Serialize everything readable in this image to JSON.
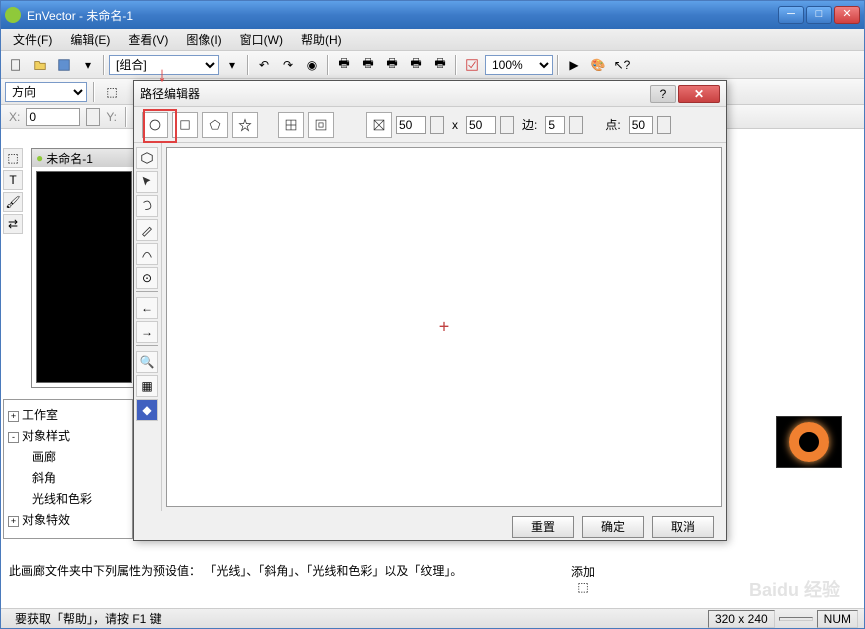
{
  "app": {
    "title": "EnVector - 未命名-1"
  },
  "menus": [
    "文件(F)",
    "编辑(E)",
    "查看(V)",
    "图像(I)",
    "窗口(W)",
    "帮助(H)"
  ],
  "toolbar": {
    "combo": "[组合]",
    "zoom": "100%"
  },
  "toolbar2": {
    "direction_label": "方向",
    "x_label": "X:",
    "x_value": "0",
    "y_label": "Y:"
  },
  "doc": {
    "title": "未命名-1"
  },
  "tree": {
    "items": [
      "工作室",
      "对象样式",
      "画廊",
      "斜角",
      "光线和色彩",
      "对象特效"
    ]
  },
  "dialog": {
    "title": "路径编辑器",
    "size_x": "50",
    "size_y": "50",
    "edges_label": "边:",
    "edges": "5",
    "points_label": "点:",
    "points": "50",
    "reset": "重置",
    "ok": "确定",
    "cancel": "取消"
  },
  "info": {
    "text": "此画廊文件夹中下列属性为预设值： 「光线」、「斜角」、「光线和色彩」以及「纹理」。",
    "add_label": "添加"
  },
  "status": {
    "help": "要获取「帮助」，请按 F1 键",
    "dims": "320 x 240",
    "num": "NUM"
  },
  "watermark": "Baidu 经验"
}
